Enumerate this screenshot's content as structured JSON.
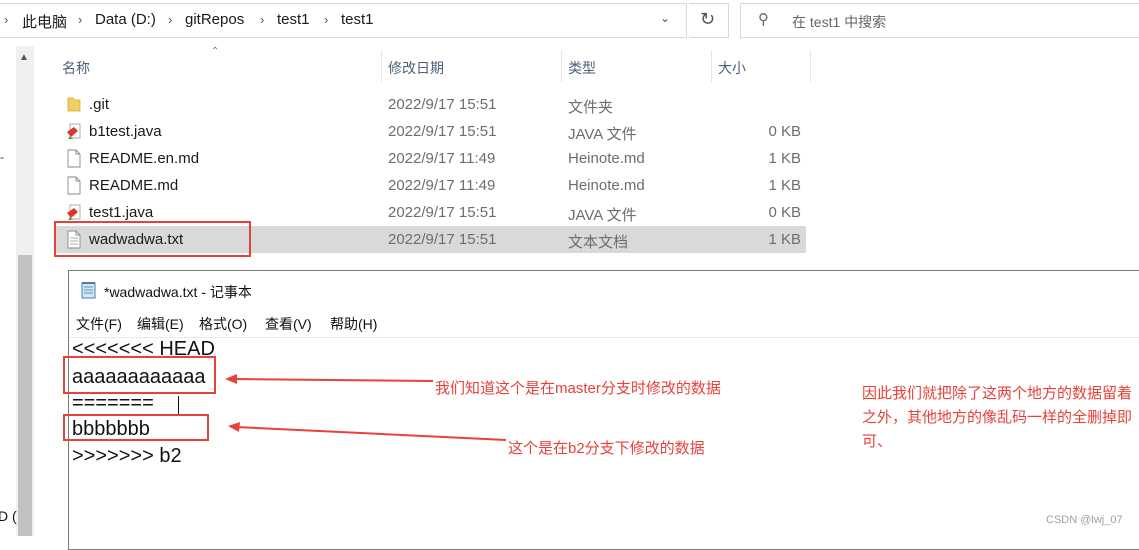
{
  "explorer": {
    "breadcrumb": [
      "此电脑",
      "Data (D:)",
      "gitRepos",
      "test1",
      "test1"
    ],
    "search_placeholder": "在 test1 中搜索",
    "nav_fragment": "D (",
    "columns": {
      "name": "名称",
      "date": "修改日期",
      "type": "类型",
      "size": "大小"
    },
    "files": [
      {
        "name": ".git",
        "date": "2022/9/17 15:51",
        "type": "文件夹",
        "size": "",
        "icon": "folder-icon"
      },
      {
        "name": "b1test.java",
        "date": "2022/9/17 15:51",
        "type": "JAVA 文件",
        "size": "0 KB",
        "icon": "java-file-icon"
      },
      {
        "name": "README.en.md",
        "date": "2022/9/17 11:49",
        "type": "Heinote.md",
        "size": "1 KB",
        "icon": "document-icon"
      },
      {
        "name": "README.md",
        "date": "2022/9/17 11:49",
        "type": "Heinote.md",
        "size": "1 KB",
        "icon": "document-icon"
      },
      {
        "name": "test1.java",
        "date": "2022/9/17 15:51",
        "type": "JAVA 文件",
        "size": "0 KB",
        "icon": "java-file-icon"
      },
      {
        "name": "wadwadwa.txt",
        "date": "2022/9/17 15:51",
        "type": "文本文档",
        "size": "1 KB",
        "icon": "text-file-icon",
        "selected": true
      }
    ]
  },
  "notepad": {
    "title": "*wadwadwa.txt - 记事本",
    "menu": [
      "文件(F)",
      "编辑(E)",
      "格式(O)",
      "查看(V)",
      "帮助(H)"
    ],
    "lines": [
      "<<<<<<< HEAD",
      "aaaaaaaaaaaa",
      "=======",
      "bbbbbbb",
      ">>>>>>> b2"
    ]
  },
  "annotations": {
    "master_note": "我们知道这个是在master分支时修改的数据",
    "b2_note": "这个是在b2分支下修改的数据",
    "side_note": "因此我们就把除了这两个地方的数据留着之外，其他地方的像乱码一样的全删掉即可、",
    "color": "#e8413b"
  },
  "watermark": "CSDN @lwj_07"
}
